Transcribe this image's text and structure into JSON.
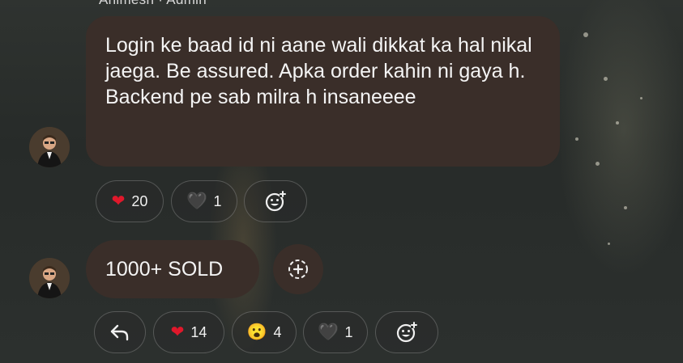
{
  "header": {
    "sender_partial": "Animesh · Admin"
  },
  "messages": [
    {
      "text": "Login ke baad id ni aane wali dikkat ka hal nikal jaega. Be assured. Apka order kahin ni gaya h. Backend pe sab milra h insaneeee",
      "reactions": [
        {
          "emoji": "❤",
          "count": "20"
        },
        {
          "emoji": "🖤",
          "count": "1"
        }
      ]
    },
    {
      "text": "1000+ SOLD",
      "reactions": [
        {
          "emoji": "❤",
          "count": "14"
        },
        {
          "emoji": "😮",
          "count": "4"
        },
        {
          "emoji": "🖤",
          "count": "1"
        }
      ]
    }
  ],
  "icons": {
    "reply": "reply-arrow-icon",
    "add_reaction": "add-reaction-icon",
    "add_emoji": "dashed-plus-icon"
  },
  "colors": {
    "bubble": "#3a2e29",
    "heart": "#e0182b",
    "pill_border": "#5a5a5a"
  }
}
